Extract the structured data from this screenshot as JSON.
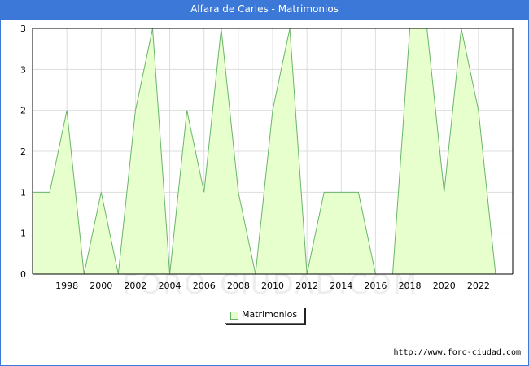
{
  "header": {
    "title": "Alfara de Carles - Matrimonios"
  },
  "watermark": "FORO-CIUDAD.COM",
  "source": "http://www.foro-ciudad.com",
  "colors": {
    "title_bar": "#3c78d8",
    "area_fill": "#e6ffcc",
    "area_line": "#6ab56a",
    "grid": "#dddddd"
  },
  "chart_data": {
    "type": "area",
    "title": "Alfara de Carles - Matrimonios",
    "xlabel": "",
    "ylabel": "",
    "x": [
      1996,
      1997,
      1998,
      1999,
      2000,
      2001,
      2002,
      2003,
      2004,
      2005,
      2006,
      2007,
      2008,
      2009,
      2010,
      2011,
      2012,
      2013,
      2014,
      2015,
      2016,
      2017,
      2018,
      2019,
      2020,
      2021,
      2022,
      2023
    ],
    "series": [
      {
        "name": "Matrimonios",
        "values": [
          1,
          1,
          2,
          0,
          1,
          0,
          2,
          3,
          0,
          2,
          1,
          3,
          1,
          0,
          2,
          3,
          0,
          1,
          1,
          1,
          0,
          0,
          3,
          3,
          1,
          3,
          2,
          0
        ]
      }
    ],
    "xlim": [
      1996,
      2024
    ],
    "ylim": [
      0,
      3
    ],
    "x_ticks": [
      "1998",
      "2000",
      "2002",
      "2004",
      "2006",
      "2008",
      "2010",
      "2012",
      "2014",
      "2016",
      "2018",
      "2020",
      "2022"
    ],
    "y_ticks": [
      "0",
      "1",
      "1",
      "2",
      "2",
      "3",
      "3"
    ],
    "grid": true,
    "legend": {
      "position": "bottom",
      "entries": [
        "Matrimonios"
      ]
    }
  }
}
